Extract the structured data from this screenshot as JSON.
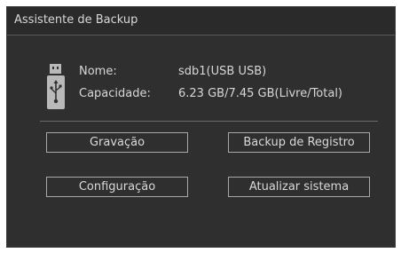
{
  "dialog": {
    "title": "Assistente de Backup"
  },
  "device": {
    "icon": "usb-drive-icon",
    "name_label": "Nome:",
    "name_value": "sdb1(USB USB)",
    "capacity_label": "Capacidade:",
    "capacity_value": "6.23 GB/7.45 GB(Livre/Total)"
  },
  "buttons": {
    "recording": "Gravação",
    "log_backup": "Backup de Registro",
    "configuration": "Configuração",
    "update_system": "Atualizar sistema"
  },
  "colors": {
    "background": "#2f2f2f",
    "text": "#d7d7d7",
    "button_border": "#a8a8a8"
  }
}
